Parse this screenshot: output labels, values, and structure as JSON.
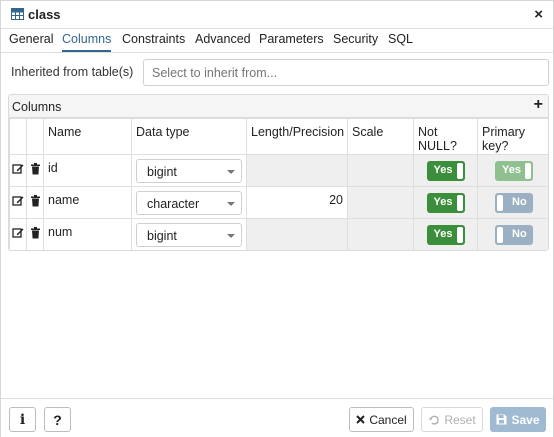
{
  "window": {
    "title": "class",
    "close_glyph": "×"
  },
  "tabs": [
    {
      "label": "General",
      "active": false
    },
    {
      "label": "Columns",
      "active": true
    },
    {
      "label": "Constraints",
      "active": false
    },
    {
      "label": "Advanced",
      "active": false
    },
    {
      "label": "Parameters",
      "active": false
    },
    {
      "label": "Security",
      "active": false
    },
    {
      "label": "SQL",
      "active": false
    }
  ],
  "inherit": {
    "label": "Inherited from table(s)",
    "placeholder": "Select to inherit from..."
  },
  "columns_panel": {
    "title": "Columns",
    "add_glyph": "+",
    "headers": {
      "name": "Name",
      "data_type": "Data type",
      "length": "Length/Precision",
      "scale": "Scale",
      "not_null": "Not NULL?",
      "primary_key": "Primary key?"
    },
    "rows": [
      {
        "name": "id",
        "data_type": "bigint",
        "length": "",
        "scale": "",
        "not_null": "Yes",
        "primary_key": "Yes"
      },
      {
        "name": "name",
        "data_type": "character",
        "length": "20",
        "scale": "",
        "not_null": "Yes",
        "primary_key": "No"
      },
      {
        "name": "num",
        "data_type": "bigint",
        "length": "",
        "scale": "",
        "not_null": "Yes",
        "primary_key": "No"
      }
    ]
  },
  "footer": {
    "info_glyph": "i",
    "help_glyph": "?",
    "cancel_label": "Cancel",
    "reset_label": "Reset",
    "save_label": "Save"
  },
  "colors": {
    "accent": "#326690",
    "toggle_on": "#3b8e3b",
    "toggle_off": "#9bb0c3",
    "save_disabled": "#9fbad1"
  },
  "icons": [
    "table-icon",
    "close-icon",
    "add-icon",
    "edit-icon",
    "trash-icon",
    "dropdown-caret-icon",
    "info-icon",
    "help-icon",
    "cancel-icon",
    "reset-icon",
    "save-icon"
  ]
}
